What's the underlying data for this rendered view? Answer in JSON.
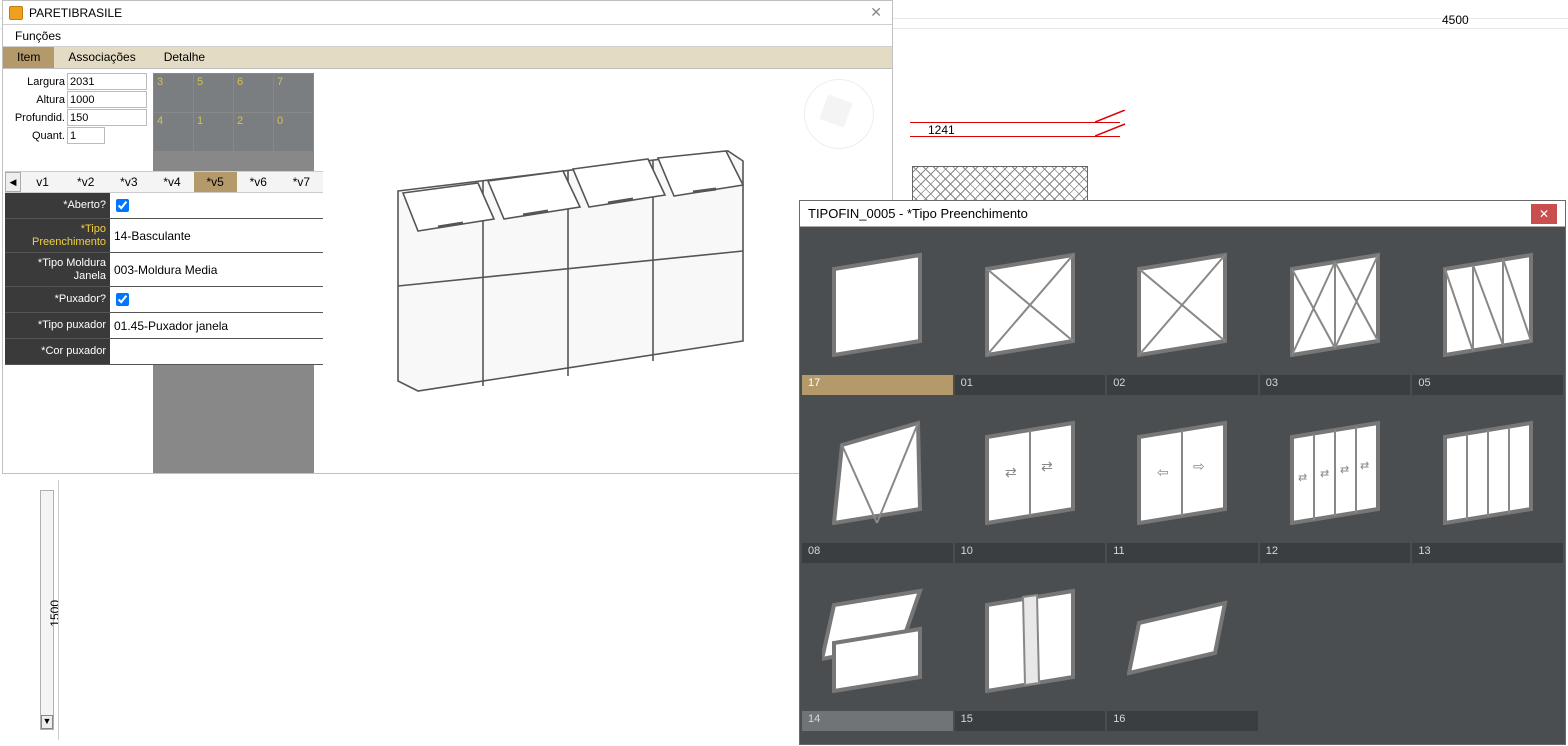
{
  "canvas": {
    "dim_top": "4500",
    "dim_left": "1500",
    "dim_red": "1241"
  },
  "mainpanel": {
    "title": "PARETIBRASILE",
    "menu": {
      "funcoes": "Funções"
    },
    "tabs": {
      "item": "Item",
      "assoc": "Associações",
      "detalhe": "Detalhe"
    },
    "dims": {
      "largura_label": "Largura",
      "largura_val": "2031",
      "altura_label": "Altura",
      "altura_val": "1000",
      "profund_label": "Profundid.",
      "profund_val": "150",
      "quant_label": "Quant.",
      "quant_val": "1"
    },
    "grid": [
      [
        "3",
        "5",
        "6",
        "7"
      ],
      [
        "4",
        "1",
        "2",
        "0"
      ]
    ],
    "vtabs": [
      "v1",
      "*v2",
      "*v3",
      "*v4",
      "*v5",
      "*v6",
      "*v7"
    ],
    "vtabs_active": 4,
    "props": [
      {
        "label": "*Aberto?",
        "type": "check",
        "value": true
      },
      {
        "label": "*Tipo Preenchimento",
        "type": "text",
        "value": "14-Basculante",
        "highlight": true,
        "tall": true
      },
      {
        "label": "*Tipo Moldura Janela",
        "type": "text",
        "value": "003-Moldura Media",
        "tall": true
      },
      {
        "label": "*Puxador?",
        "type": "check",
        "value": true
      },
      {
        "label": "*Tipo puxador",
        "type": "text",
        "value": "01.45-Puxador janela"
      },
      {
        "label": "*Cor puxador",
        "type": "text",
        "value": ""
      }
    ]
  },
  "popup": {
    "title": "TIPOFIN_0005 - *Tipo Preenchimento",
    "items": [
      {
        "id": "17",
        "code": "17",
        "shape": "plain",
        "selected": "sel"
      },
      {
        "id": "01",
        "code": "01",
        "shape": "x1"
      },
      {
        "id": "02",
        "code": "02",
        "shape": "x1r"
      },
      {
        "id": "03",
        "code": "03",
        "shape": "x2"
      },
      {
        "id": "05",
        "code": "05",
        "shape": "x3"
      },
      {
        "id": "08",
        "code": "08",
        "shape": "tilt"
      },
      {
        "id": "10",
        "code": "10",
        "shape": "slide2"
      },
      {
        "id": "11",
        "code": "11",
        "shape": "slide2b"
      },
      {
        "id": "12",
        "code": "12",
        "shape": "slide4"
      },
      {
        "id": "13",
        "code": "13",
        "shape": "fold4"
      },
      {
        "id": "14",
        "code": "14",
        "shape": "awning",
        "selected": "sel2"
      },
      {
        "id": "15",
        "code": "15",
        "shape": "pivot"
      },
      {
        "id": "16",
        "code": "16",
        "shape": "flap"
      }
    ]
  }
}
